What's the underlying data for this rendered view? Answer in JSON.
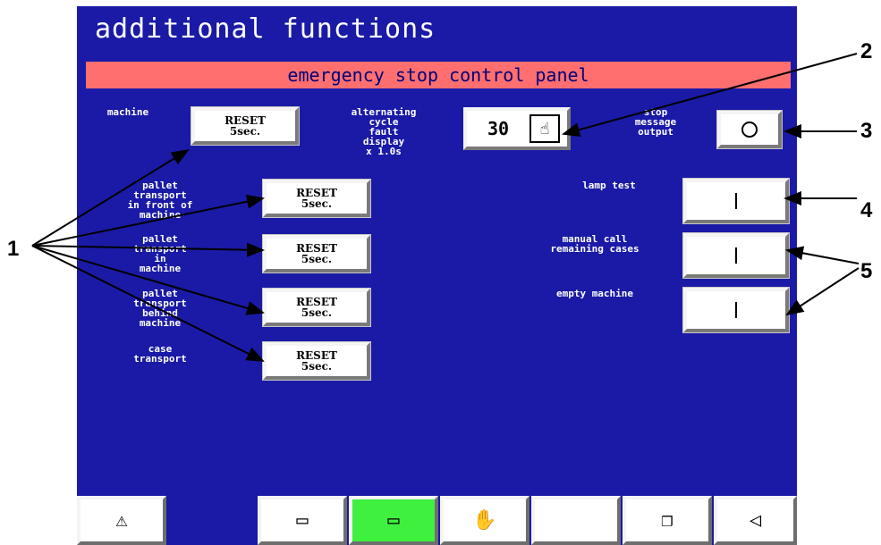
{
  "screen": {
    "title": "additional functions",
    "banner": "emergency stop control panel"
  },
  "left_controls": [
    {
      "label": "machine",
      "button_line1": "RESET",
      "button_line2": "5sec."
    },
    {
      "label": "pallet\ntransport\nin front of\nmachine",
      "button_line1": "RESET",
      "button_line2": "5sec."
    },
    {
      "label": "pallet\ntransport\nin\nmachine",
      "button_line1": "RESET",
      "button_line2": "5sec."
    },
    {
      "label": "pallet\ntransport\nbehind\nmachine",
      "button_line1": "RESET",
      "button_line2": "5sec."
    },
    {
      "label": "case\ntransport",
      "button_line1": "RESET",
      "button_line2": "5sec."
    }
  ],
  "cycle": {
    "label": "alternating\ncycle\nfault\ndisplay\nx 1.0s",
    "value": "30",
    "icon": "hand-pointer-icon"
  },
  "stop_message": {
    "label": "stop\nmessage\noutput",
    "symbol": "O"
  },
  "right_controls": [
    {
      "label": "lamp test",
      "symbol": "I"
    },
    {
      "label": "manual call\nremaining cases",
      "symbol": "I"
    },
    {
      "label": "empty machine",
      "symbol": "I"
    }
  ],
  "function_keys": [
    {
      "icon": "warning-icon",
      "glyph": "⚠",
      "active": false
    },
    {
      "icon": "mode-screen-icon",
      "glyph": "▭",
      "active": false
    },
    {
      "icon": "mode-screen-active-icon",
      "glyph": "▭",
      "active": true
    },
    {
      "icon": "hand-icon",
      "glyph": "✋",
      "active": false
    },
    {
      "icon": "blank-key",
      "glyph": "",
      "active": false
    },
    {
      "icon": "documents-icon",
      "glyph": "❐",
      "active": false
    },
    {
      "icon": "back-arrow-icon",
      "glyph": "◁",
      "active": false
    }
  ],
  "callouts": {
    "c1": "1",
    "c2": "2",
    "c3": "3",
    "c4": "4",
    "c5": "5"
  },
  "colors": {
    "screen_bg": "#1a1aa6",
    "banner_bg": "#ff6f6f",
    "active_key": "#3ff03f"
  }
}
